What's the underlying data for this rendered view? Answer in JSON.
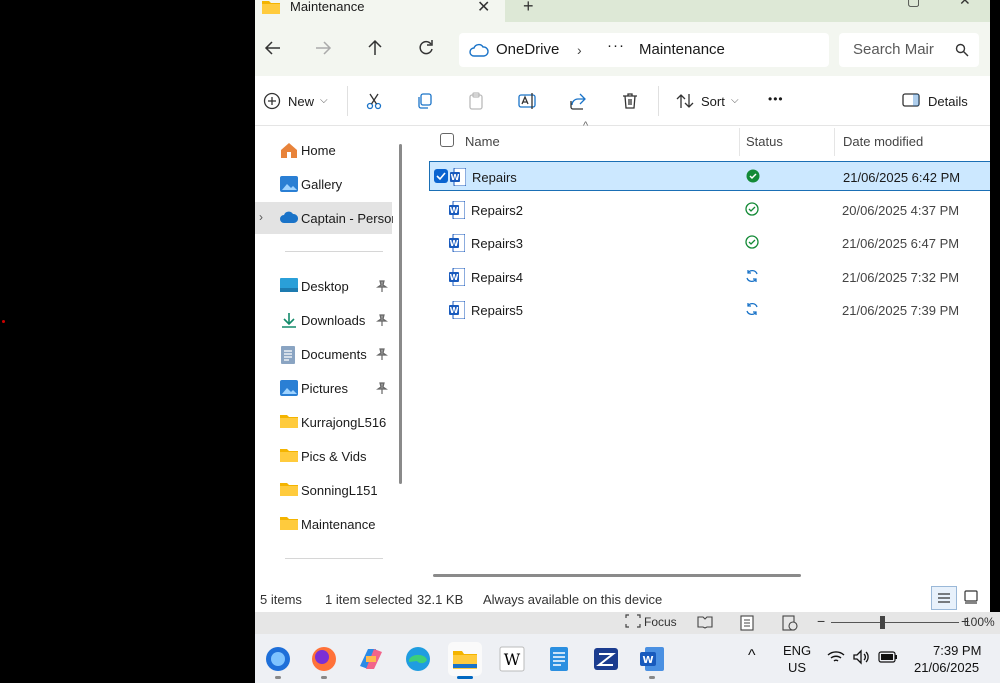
{
  "window": {
    "tab_title": "Maintenance",
    "new_tab": "+"
  },
  "address": {
    "root": "OneDrive",
    "overflow": "···",
    "current": "Maintenance"
  },
  "search": {
    "placeholder": "Search Mair"
  },
  "toolbar": {
    "new_label": "New",
    "sort_label": "Sort",
    "more": "•••",
    "details_label": "Details"
  },
  "nav": {
    "home": "Home",
    "gallery": "Gallery",
    "onedrive": "Captain - Personal",
    "quick": [
      {
        "label": "Desktop",
        "icon": "desktop-icon",
        "pinned": true
      },
      {
        "label": "Downloads",
        "icon": "download-icon",
        "pinned": true
      },
      {
        "label": "Documents",
        "icon": "documents-icon",
        "pinned": true
      },
      {
        "label": "Pictures",
        "icon": "pictures-icon",
        "pinned": true
      },
      {
        "label": "KurrajongL516",
        "icon": "folder-icon",
        "pinned": false
      },
      {
        "label": "Pics & Vids",
        "icon": "folder-icon",
        "pinned": false
      },
      {
        "label": "SonningL151",
        "icon": "folder-icon",
        "pinned": false
      },
      {
        "label": "Maintenance",
        "icon": "folder-icon",
        "pinned": false
      }
    ]
  },
  "columns": {
    "name": "Name",
    "status": "Status",
    "date": "Date modified"
  },
  "files": [
    {
      "name": "Repairs",
      "status": "available-offline",
      "date": "21/06/2025 6:42 PM",
      "selected": true
    },
    {
      "name": "Repairs2",
      "status": "available",
      "date": "20/06/2025 4:37 PM",
      "selected": false
    },
    {
      "name": "Repairs3",
      "status": "available",
      "date": "21/06/2025 6:47 PM",
      "selected": false
    },
    {
      "name": "Repairs4",
      "status": "syncing",
      "date": "21/06/2025 7:32 PM",
      "selected": false
    },
    {
      "name": "Repairs5",
      "status": "syncing",
      "date": "21/06/2025 7:39 PM",
      "selected": false
    }
  ],
  "status": {
    "count": "5 items",
    "selected": "1 item selected",
    "size": "32.1 KB",
    "availability": "Always available on this device"
  },
  "word": {
    "focus": "Focus",
    "zoom": "100%"
  },
  "tray": {
    "lang1": "ENG",
    "lang2": "US",
    "time": "7:39 PM",
    "date": "21/06/2025"
  },
  "colors": {
    "accent": "#0067c0",
    "selection": "#cce8ff",
    "ok": "#138a36",
    "sync": "#1a73c8"
  }
}
